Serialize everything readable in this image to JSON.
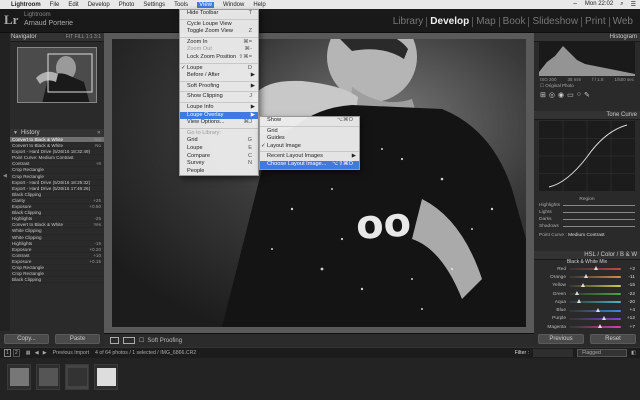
{
  "menubar": {
    "apple": "",
    "app": "Lightroom",
    "items": [
      "File",
      "Edit",
      "Develop",
      "Photo",
      "Settings",
      "Tools",
      "View",
      "Window",
      "Help"
    ],
    "active": "View",
    "clock": "Mon 22:02"
  },
  "identity": {
    "app_label": "Lightroom",
    "user": "Arnaud Porterie",
    "logo": "Lr"
  },
  "modules": [
    "Library",
    "Develop",
    "Map",
    "Book",
    "Slideshow",
    "Print",
    "Web"
  ],
  "current_module": "Develop",
  "navigator": {
    "title": "Navigator",
    "modes": "FIT  FILL  1:1  3:1"
  },
  "history": {
    "title": "History",
    "items": [
      {
        "label": "Convert to Black & White",
        "value": "Yes"
      },
      {
        "label": "Convert to Black & White",
        "value": "No"
      },
      {
        "label": "Export - Hard Drive (5/26/16 18:32:49)",
        "value": ""
      },
      {
        "label": "Point Curve: Medium Contrast",
        "value": ""
      },
      {
        "label": "Contrast",
        "value": "+8"
      },
      {
        "label": "Crop Rectangle",
        "value": ""
      },
      {
        "label": "Crop Rectangle",
        "value": ""
      },
      {
        "label": "Export - Hard Drive (5/26/16 18:25:32)",
        "value": ""
      },
      {
        "label": "Export - Hard Drive (5/26/16 17:46:26)",
        "value": ""
      },
      {
        "label": "Black Clipping",
        "value": ""
      },
      {
        "label": "Clarity",
        "value": "+25"
      },
      {
        "label": "Exposure",
        "value": "+0.50"
      },
      {
        "label": "Black Clipping",
        "value": ""
      },
      {
        "label": "Highlights",
        "value": "-25"
      },
      {
        "label": "Convert to Black & White",
        "value": "Yes"
      },
      {
        "label": "White Clipping",
        "value": ""
      },
      {
        "label": "White Clipping",
        "value": ""
      },
      {
        "label": "Highlights",
        "value": "-15"
      },
      {
        "label": "Exposure",
        "value": "+0.20"
      },
      {
        "label": "Contrast",
        "value": "+10"
      },
      {
        "label": "Exposure",
        "value": "+0.15"
      },
      {
        "label": "Crop Rectangle",
        "value": ""
      },
      {
        "label": "Crop Rectangle",
        "value": ""
      },
      {
        "label": "Black Clipping",
        "value": ""
      }
    ]
  },
  "left_buttons": {
    "copy": "Copy...",
    "paste": "Paste"
  },
  "toolbar": {
    "soft_proofing": "Soft Proofing"
  },
  "histogram": {
    "title": "Histogram",
    "iso": "ISO 200",
    "focal": "35 mm",
    "aperture": "f / 1.8",
    "shutter": "1/500 sec",
    "original_photo": "Original Photo"
  },
  "tone_curve": {
    "title": "Tone Curve",
    "region": "Region",
    "point_curve_label": "Point Curve :",
    "point_curve_value": "Medium Contrast",
    "sliders": [
      "Highlights",
      "Lights",
      "Darks",
      "Shadows"
    ]
  },
  "bw_mix": {
    "header": "HSL / Color / B & W",
    "title": "Black & White Mix",
    "rows": [
      {
        "label": "Red",
        "value": "+2",
        "color": "#c44"
      },
      {
        "label": "Orange",
        "value": "-11",
        "color": "#d84"
      },
      {
        "label": "Yellow",
        "value": "-15",
        "color": "#cc4"
      },
      {
        "label": "Green",
        "value": "-22",
        "color": "#4a4"
      },
      {
        "label": "Aqua",
        "value": "-20",
        "color": "#4bb"
      },
      {
        "label": "Blue",
        "value": "+4",
        "color": "#48c"
      },
      {
        "label": "Purple",
        "value": "+12",
        "color": "#84c"
      },
      {
        "label": "Magenta",
        "value": "+7",
        "color": "#c4a"
      }
    ]
  },
  "right_buttons": {
    "previous": "Previous",
    "reset": "Reset"
  },
  "filmstrip": {
    "pages": [
      "1",
      "2"
    ],
    "source": "Previous Import",
    "count": "4 of 64 photos / 1 selected / IMG_6866.CR2",
    "filter_label": "Filter :",
    "filter_value": "Flagged"
  },
  "view_menu": {
    "items": [
      {
        "label": "Hide Toolbar",
        "shortcut": "T"
      },
      {
        "sep": true
      },
      {
        "label": "Cycle Loupe View",
        "shortcut": ""
      },
      {
        "label": "Toggle Zoom View",
        "shortcut": "Z"
      },
      {
        "sep": true
      },
      {
        "label": "Zoom In",
        "shortcut": "⌘="
      },
      {
        "label": "Zoom Out",
        "shortcut": "⌘-",
        "disabled": true
      },
      {
        "label": "Lock Zoom Position",
        "shortcut": "⇧⌘="
      },
      {
        "sep": true
      },
      {
        "label": "Loupe",
        "shortcut": "D",
        "check": true
      },
      {
        "label": "Before / After",
        "shortcut": "",
        "submenu": true
      },
      {
        "sep": true
      },
      {
        "label": "Soft Proofing",
        "shortcut": "",
        "submenu": true
      },
      {
        "sep": true
      },
      {
        "label": "Show Clipping",
        "shortcut": "J"
      },
      {
        "sep": true
      },
      {
        "label": "Loupe Info",
        "shortcut": "",
        "submenu": true
      },
      {
        "label": "Loupe Overlay",
        "shortcut": "",
        "submenu": true,
        "highlight": true
      },
      {
        "label": "View Options...",
        "shortcut": "⌘J"
      },
      {
        "sep": true
      },
      {
        "label": "Go to Library:",
        "shortcut": "",
        "disabled": true
      },
      {
        "label": "Grid",
        "shortcut": "G"
      },
      {
        "label": "Loupe",
        "shortcut": "E"
      },
      {
        "label": "Compare",
        "shortcut": "C"
      },
      {
        "label": "Survey",
        "shortcut": "N"
      },
      {
        "label": "People",
        "shortcut": ""
      }
    ]
  },
  "overlay_submenu": {
    "items": [
      {
        "label": "Show",
        "shortcut": "⌥⌘O"
      },
      {
        "sep": true
      },
      {
        "label": "Grid",
        "shortcut": ""
      },
      {
        "label": "Guides",
        "shortcut": ""
      },
      {
        "label": "Layout Image",
        "shortcut": "",
        "check": true
      },
      {
        "sep": true
      },
      {
        "label": "Recent Layout Images",
        "shortcut": "",
        "submenu": true
      },
      {
        "label": "Choose Layout Image...",
        "shortcut": "⌥⇧⌘O",
        "highlight": true
      }
    ]
  }
}
